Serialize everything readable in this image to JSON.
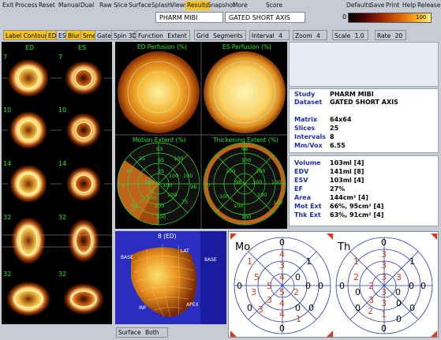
{
  "menu": {
    "left": [
      "Exit",
      "Process",
      "Reset",
      "Manual",
      "Dual"
    ],
    "middle": [
      "Raw",
      "Slice",
      "Surface",
      "Splash",
      "Views",
      "Results",
      "Snapshot",
      "More",
      "Score"
    ],
    "active": "Results",
    "right": [
      "Defaults",
      "Save",
      "Print",
      "Help",
      "Release"
    ]
  },
  "fields": {
    "study": "PHARM MIBI",
    "dataset": "GATED SHORT AXIS"
  },
  "colorbar": {
    "min": "0",
    "max": "100"
  },
  "toolbar2": {
    "label_contours": "Label Contours",
    "ed": "ED",
    "es": "ES",
    "blur": "Blur",
    "smear": "Smear",
    "gate": "Gate",
    "spin3d": "Spin 3D",
    "function_label": "Function",
    "function_value": "Extent",
    "grid_label": "Grid",
    "grid_value": "Segments",
    "interval_label": "Interval",
    "interval_value": "4",
    "zoom_label": "Zoom",
    "zoom_value": "4",
    "scale_label": "Scale",
    "scale_value": "1.0",
    "rate_label": "Rate",
    "rate_value": "20"
  },
  "slices": {
    "col_ed": "ED",
    "col_es": "ES",
    "rows": [
      "7",
      "10",
      "14",
      "32",
      "32"
    ]
  },
  "polar_titles": {
    "ed_perfusion": "ED Perfusion (%)",
    "es_perfusion": "ES Perfusion (%)",
    "motion": "Motion Extent (%)",
    "thickening": "Thickening Extent (%)"
  },
  "motion_values": [
    "93",
    "55",
    "95",
    "100",
    "47",
    "35",
    "100",
    "100",
    "100",
    "0",
    "100",
    "98",
    "100",
    "100",
    "75",
    "100",
    "42",
    "100",
    "100",
    "100"
  ],
  "thick_values": [
    "98",
    "100",
    "100",
    "100",
    "0",
    "96",
    "100",
    "100",
    "100",
    "100",
    "100",
    "100",
    "100",
    "100",
    "100",
    "100"
  ],
  "info1": [
    {
      "k": "Study",
      "v": "PHARM MIBI"
    },
    {
      "k": "Dataset",
      "v": "GATED SHORT AXIS"
    },
    {
      "k": "Matrix",
      "v": "64x64"
    },
    {
      "k": "Slices",
      "v": "25"
    },
    {
      "k": "Intervals",
      "v": "8"
    },
    {
      "k": "Mm/Vox",
      "v": "6.55"
    }
  ],
  "info2": [
    {
      "k": "Volume",
      "v": "103ml [4]"
    },
    {
      "k": "EDV",
      "v": "141ml [8]"
    },
    {
      "k": "ESV",
      "v": "103ml [4]"
    },
    {
      "k": "EF",
      "v": "27%"
    },
    {
      "k": "Area",
      "v": "144cm² [4]"
    },
    {
      "k": "Mot Ext",
      "v": "66%, 95cm² [4]"
    },
    {
      "k": "Thk Ext",
      "v": "63%, 91cm² [4]"
    }
  ],
  "surface3d": {
    "title": "8 (ED)",
    "base": "BASE",
    "lat": "LAT",
    "apex": "APEX",
    "inf": "INF",
    "base2": "BASE"
  },
  "surface_select": {
    "label": "Surface",
    "value": "Both"
  },
  "scores": {
    "mo_label": "Mo",
    "th_label": "Th",
    "mo": [
      "0",
      "1",
      "4",
      "1",
      "0",
      "0",
      "5",
      "3",
      "0",
      "0",
      "3",
      "5",
      "4",
      "5",
      "2",
      "3",
      "4",
      "3",
      "4",
      "0",
      "1",
      "0",
      "0",
      "0"
    ],
    "th": [
      "0",
      "1",
      "3",
      "1",
      "0",
      "2",
      "3",
      "0",
      "0",
      "3",
      "2",
      "3",
      "0",
      "0",
      "3",
      "3",
      "3",
      "0",
      "2",
      "1",
      "0",
      "0",
      "0",
      "0"
    ]
  }
}
